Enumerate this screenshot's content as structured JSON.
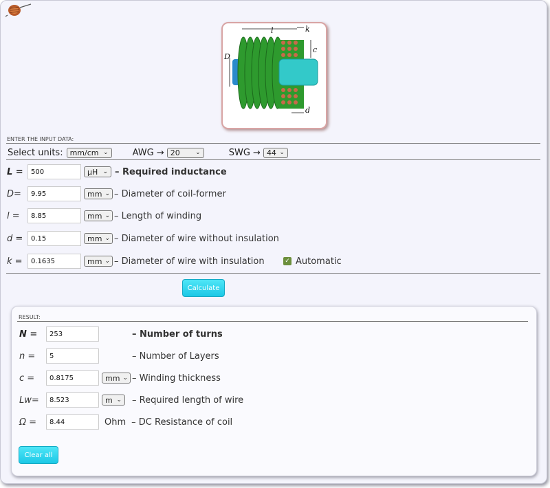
{
  "input": {
    "section_title": "ENTER THE INPUT DATA:",
    "units_label": "Select units:",
    "units_value": "mm/cm",
    "awg_label": "AWG →",
    "awg_value": "20",
    "swg_label": "SWG →",
    "swg_value": "44",
    "fields": {
      "L": {
        "symbol": "L =",
        "value": "500",
        "unit": "μH",
        "desc": "– Required inductance"
      },
      "D": {
        "symbol": "D=",
        "value": "9.95",
        "unit": "mm",
        "desc": "– Diameter of coil-former"
      },
      "l": {
        "symbol": "l =",
        "value": "8.85",
        "unit": "mm",
        "desc": "– Length of winding"
      },
      "d": {
        "symbol": "d =",
        "value": "0.15",
        "unit": "mm",
        "desc": "– Diameter of wire without insulation"
      },
      "k": {
        "symbol": "k =",
        "value": "0.1635",
        "unit": "mm",
        "desc": "– Diameter of wire with insulation"
      }
    },
    "automatic_label": "Automatic",
    "automatic_checked": true
  },
  "buttons": {
    "calculate": "Calculate",
    "clear": "Clear all"
  },
  "result": {
    "section_title": "RESULT:",
    "N": {
      "symbol": "N  =",
      "value": "253",
      "desc": "– Number of turns"
    },
    "n": {
      "symbol": "n  =",
      "value": "5",
      "desc": "– Number of Layers"
    },
    "c": {
      "symbol": "c  =",
      "value": "0.8175",
      "unit": "mm",
      "desc": "– Winding thickness"
    },
    "Lw": {
      "symbol": "Lw=",
      "value": "8.523",
      "unit": "m",
      "desc": "– Required length of wire"
    },
    "R": {
      "symbol": "Ω  =",
      "value": "8.44",
      "unit": "Ohm",
      "desc": "– DC Resistance of coil"
    }
  },
  "diagram": {
    "label_l": "l",
    "label_k": "k",
    "label_c": "c",
    "label_D": "D",
    "label_d": "d"
  },
  "colors": {
    "coil": "#2e9a2e",
    "former": "#33c9c9",
    "wire_dots": "#c86a4a",
    "button": "#1cc8e6"
  }
}
